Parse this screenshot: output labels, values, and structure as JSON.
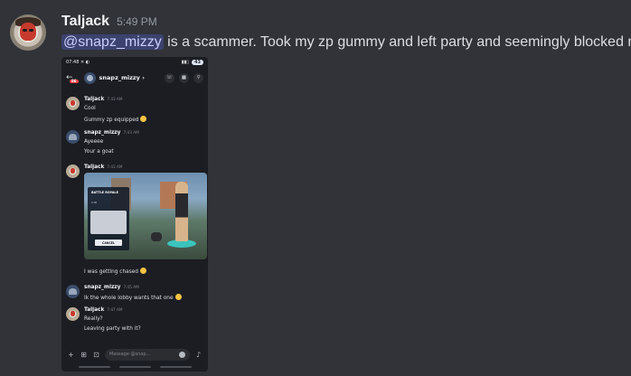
{
  "message": {
    "author": "Taljack",
    "time": "5:49 PM",
    "mention": "@snapz_mizzy",
    "text": " is a scammer. Took my zp gummy and left party and seemingly blocked me."
  },
  "screenshot": {
    "status": {
      "time": "07:48",
      "icons_left": "✕ ◐",
      "battery": "43"
    },
    "channel": {
      "name": "snapz_mizzy",
      "chevron": "›",
      "badge": "86"
    },
    "messages": [
      {
        "author": "Taljack",
        "time": "7:43 AM",
        "lines": [
          "Cool",
          "Gummy zp equipped"
        ]
      },
      {
        "author": "snapz_mizzy",
        "time": "7:43 AM",
        "lines": [
          "Ayeeee",
          "Your a goat"
        ]
      },
      {
        "author": "Taljack",
        "time": "7:43 AM",
        "lines": [
          "I was getting chased"
        ]
      },
      {
        "author": "snapz_mizzy",
        "time": "7:45 AM",
        "lines": [
          "Ik the whole lobby wants that one"
        ]
      },
      {
        "author": "Taljack",
        "time": "7:47 AM",
        "lines": [
          "Really?",
          "Leaving party with it?"
        ]
      }
    ],
    "game_image": {
      "title": "BATTLE ROYALE",
      "sub": "C18",
      "cancel": "CANCEL"
    },
    "composer": {
      "placeholder": "Message @snap..."
    }
  },
  "icons": [
    "back-arrow-icon",
    "phone-icon",
    "video-icon",
    "search-icon",
    "plus-icon",
    "gift-icon",
    "apps-icon",
    "emoji-icon",
    "microphone-icon"
  ]
}
